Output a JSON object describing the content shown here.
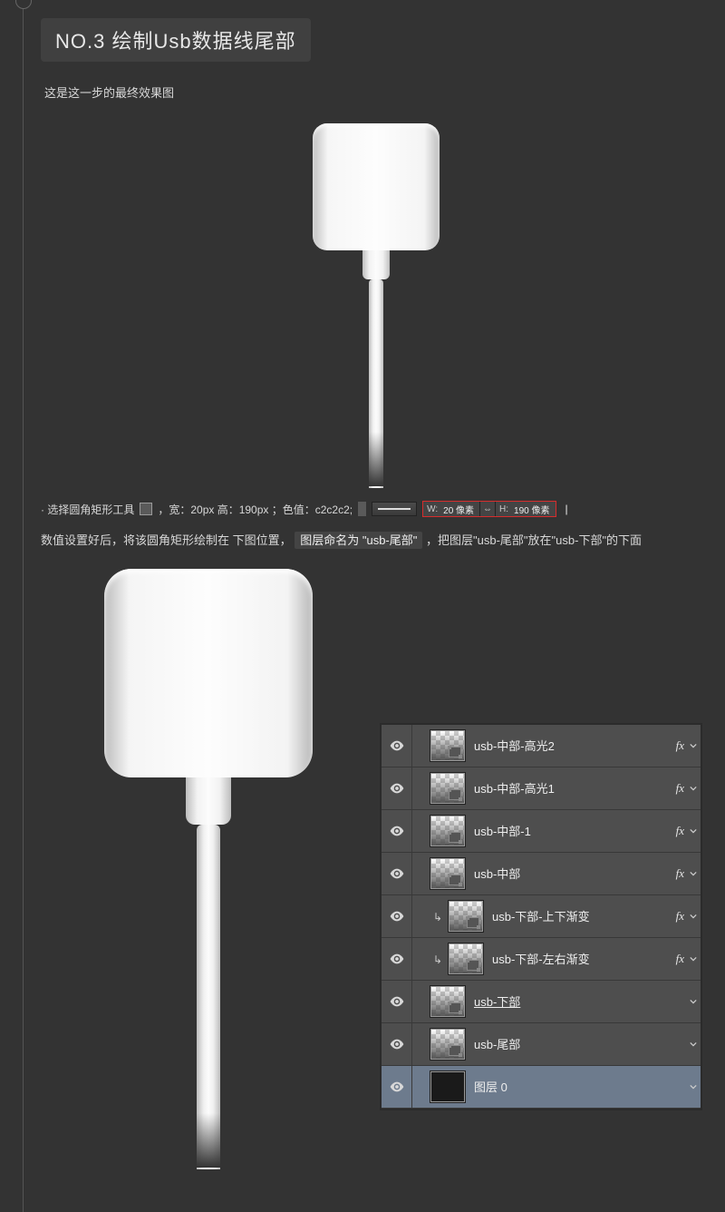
{
  "section": {
    "title": "NO.3 绘制Usb数据线尾部",
    "subtitle": "这是这一步的最终效果图"
  },
  "toolrow": {
    "prefix": "·  选择圆角矩形工具",
    "dims_text": "，宽：20px 高：190px ；色值：c2c2c2;",
    "w_lbl": "W:",
    "w_val": "20 像素",
    "h_lbl": "H:",
    "h_val": "190 像素",
    "pipe": "|"
  },
  "para": {
    "t1": "数值设置好后，将该圆角矩形绘制在 下图位置，",
    "hl": "图层命名为 \"usb-尾部\"",
    "t2": "，把图层\"usb-尾部\"放在\"usb-下部\"的下面"
  },
  "layers": [
    {
      "name": "usb-中部-高光2",
      "fx": true,
      "clip": false,
      "thumb": "shape",
      "sel": false,
      "linked": false
    },
    {
      "name": "usb-中部-高光1",
      "fx": true,
      "clip": false,
      "thumb": "shape",
      "sel": false,
      "linked": false
    },
    {
      "name": "usb-中部-1",
      "fx": true,
      "clip": false,
      "thumb": "shape",
      "sel": false,
      "linked": false
    },
    {
      "name": "usb-中部",
      "fx": true,
      "clip": false,
      "thumb": "shape",
      "sel": false,
      "linked": false
    },
    {
      "name": "usb-下部-上下渐变",
      "fx": true,
      "clip": true,
      "thumb": "shape",
      "sel": false,
      "linked": false
    },
    {
      "name": "usb-下部-左右渐变",
      "fx": true,
      "clip": true,
      "thumb": "shape",
      "sel": false,
      "linked": false
    },
    {
      "name": "usb-下部",
      "fx": false,
      "clip": false,
      "thumb": "shape",
      "sel": false,
      "linked": true
    },
    {
      "name": "usb-尾部",
      "fx": false,
      "clip": false,
      "thumb": "shape",
      "sel": false,
      "linked": false
    },
    {
      "name": "图层 0",
      "fx": false,
      "clip": false,
      "thumb": "dark",
      "sel": true,
      "linked": false
    }
  ],
  "fx_label": "fx",
  "link_glyph": "⇔"
}
